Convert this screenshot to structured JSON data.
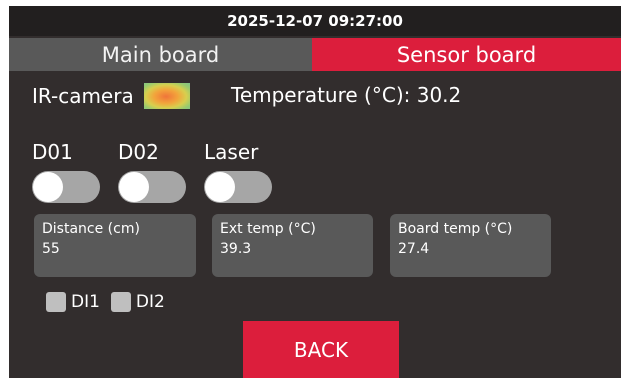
{
  "header": {
    "datetime": "2025-12-07 09:27:00"
  },
  "tabs": [
    {
      "label": "Main board",
      "active": false
    },
    {
      "label": "Sensor board",
      "active": true
    }
  ],
  "ir_camera": {
    "label": "IR-camera"
  },
  "temperature": {
    "text": "Temperature (°C): 30.2"
  },
  "switches": [
    {
      "label": "D01",
      "on": false
    },
    {
      "label": "D02",
      "on": false
    },
    {
      "label": "Laser",
      "on": false
    }
  ],
  "cards": [
    {
      "label": "Distance (cm)",
      "value": "55"
    },
    {
      "label": "Ext temp (°C)",
      "value": "39.3"
    },
    {
      "label": "Board temp (°C)",
      "value": "27.4"
    }
  ],
  "inputs": [
    {
      "label": "DI1",
      "checked": false
    },
    {
      "label": "DI2",
      "checked": false
    }
  ],
  "back_button": {
    "label": "BACK"
  },
  "colors": {
    "accent": "#dc1e3c",
    "background": "#322d2d",
    "panel": "#595959",
    "toggle_track": "#a6a6a6"
  }
}
